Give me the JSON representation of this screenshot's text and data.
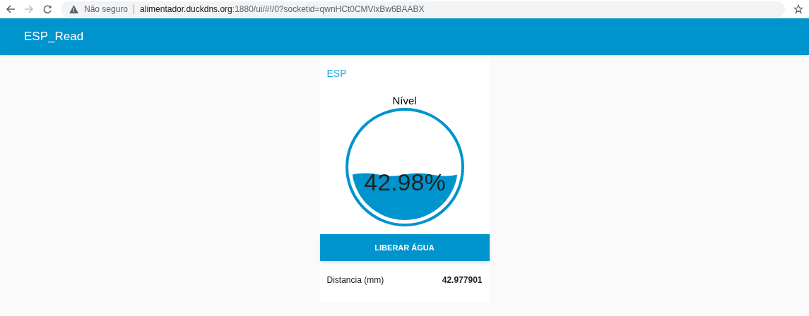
{
  "browser": {
    "security": "Não seguro",
    "url_host": "alimentador.duckdns.org",
    "url_rest": ":1880/ui/#!/0?socketid=qwnHCt0CMVlxBw6BAABX"
  },
  "header": {
    "title": "ESP_Read"
  },
  "card": {
    "title": "ESP",
    "gauge": {
      "label": "Nível",
      "level": 0.4298,
      "reading": "42.98%"
    },
    "button": "LIBERAR ÁGUA",
    "readout": {
      "label": "Distancia (mm)",
      "value": "42.977901"
    }
  }
}
